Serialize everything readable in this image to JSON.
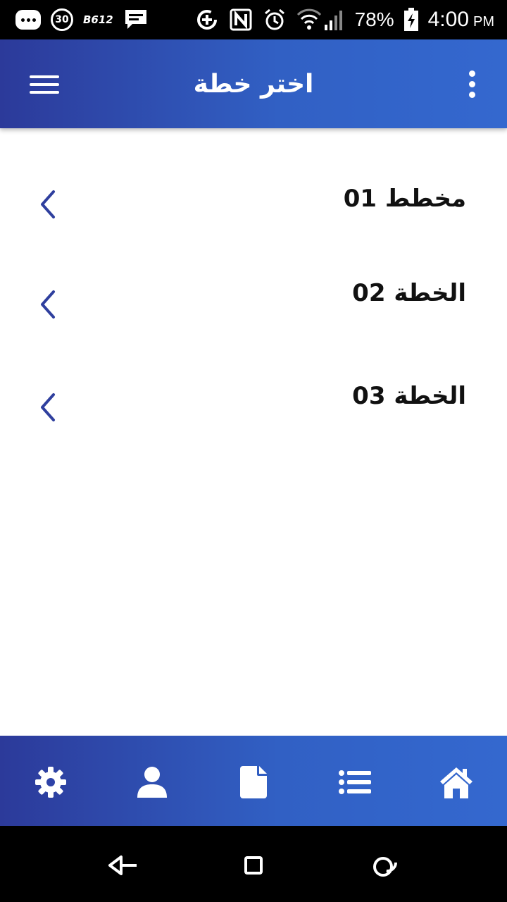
{
  "status_bar": {
    "notification_badge_text": "30",
    "app_text": "B612",
    "battery_percent": "78%",
    "time": "4:00",
    "ampm": "PM"
  },
  "app_bar": {
    "title": "اختر خطة"
  },
  "plans": [
    {
      "label": "مخطط 01"
    },
    {
      "label": "الخطة 02"
    },
    {
      "label": "الخطة 03"
    }
  ],
  "colors": {
    "accent": "#2f3f9e",
    "bar_gradient_start": "#2c3a9a",
    "bar_gradient_end": "#3468cf"
  },
  "bottom_nav": {
    "items": [
      "gear-icon",
      "user-icon",
      "document-icon",
      "list-icon",
      "home-icon"
    ]
  }
}
